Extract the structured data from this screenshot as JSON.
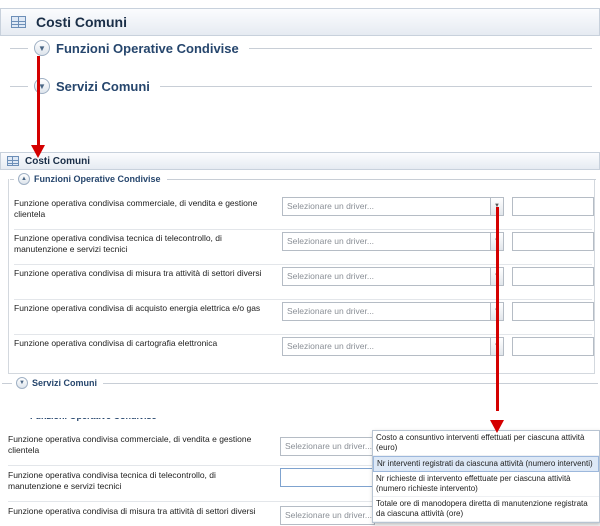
{
  "panel_title": "Costi Comuni",
  "sections": {
    "funzioni": "Funzioni Operative Condivise",
    "servizi": "Servizi Comuni"
  },
  "combo_placeholder": "Selezionare un driver...",
  "rows": [
    {
      "label": "Funzione operativa condivisa commerciale, di vendita e gestione clientela"
    },
    {
      "label": "Funzione operativa condivisa tecnica di telecontrollo, di manutenzione e servizi tecnici"
    },
    {
      "label": "Funzione operativa condivisa di misura tra attività di settori diversi"
    },
    {
      "label": "Funzione operativa condivisa di acquisto energia elettrica e/o gas"
    },
    {
      "label": "Funzione operativa condivisa di cartografia elettronica"
    }
  ],
  "dropdown_options": [
    "Costo a consuntivo interventi effettuati per ciascuna attività (euro)",
    "Nr interventi registrati da ciascuna attività (numero interventi)",
    "Nr richieste di intervento effettuate per ciascuna attività (numero richieste intervento)",
    "Totale ore di manodopera diretta di manutenzione registrata da ciascuna attività (ore)"
  ],
  "dropdown_selected_index": 1,
  "colors": {
    "arrow": "#d40000",
    "section_title": "#26466d",
    "selected_option": "#dde8f6"
  }
}
